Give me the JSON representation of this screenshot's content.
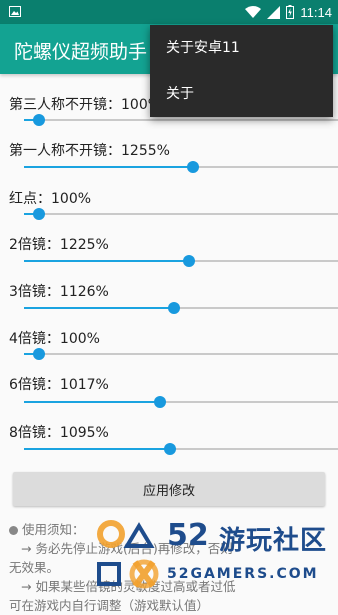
{
  "status_bar": {
    "time": "11:14",
    "icons": [
      "image-icon",
      "wifi-icon",
      "signal-icon",
      "battery-charging-icon"
    ]
  },
  "app_bar": {
    "title": "陀螺仪超频助手"
  },
  "overflow_menu": {
    "items": [
      "关于安卓11",
      "关于"
    ]
  },
  "settings": [
    {
      "label": "第三人称不开镜：",
      "value": "100%",
      "fraction": 0.05
    },
    {
      "label": "第一人称不开镜：",
      "value": "1255%",
      "fraction": 0.58
    },
    {
      "label": "红点：",
      "value": "100%",
      "fraction": 0.05
    },
    {
      "label": "2倍镜：",
      "value": "1225%",
      "fraction": 0.565
    },
    {
      "label": "3倍镜：",
      "value": "1126%",
      "fraction": 0.515
    },
    {
      "label": "4倍镜：",
      "value": "100%",
      "fraction": 0.05
    },
    {
      "label": "6倍镜：",
      "value": "1017%",
      "fraction": 0.465
    },
    {
      "label": "8倍镜：",
      "value": "1095%",
      "fraction": 0.5
    }
  ],
  "apply_button": {
    "label": "应用修改"
  },
  "notes": {
    "title": "使用须知：",
    "lines": [
      "→ 务必先停止游戏(后台)再修改，否则",
      "无效果。",
      "→ 如果某些倍镜的灵敏度过高或者过低",
      "可在游戏内自行调整（游戏默认值）"
    ]
  },
  "watermark": {
    "number": "52",
    "chinese": "游玩社区",
    "english": "52GAMERS.COM"
  },
  "colors": {
    "status_bar": "#0a7f6e",
    "app_bar": "#13a392",
    "slider_accent": "#1899de",
    "menu_bg": "#2a2a2a"
  }
}
